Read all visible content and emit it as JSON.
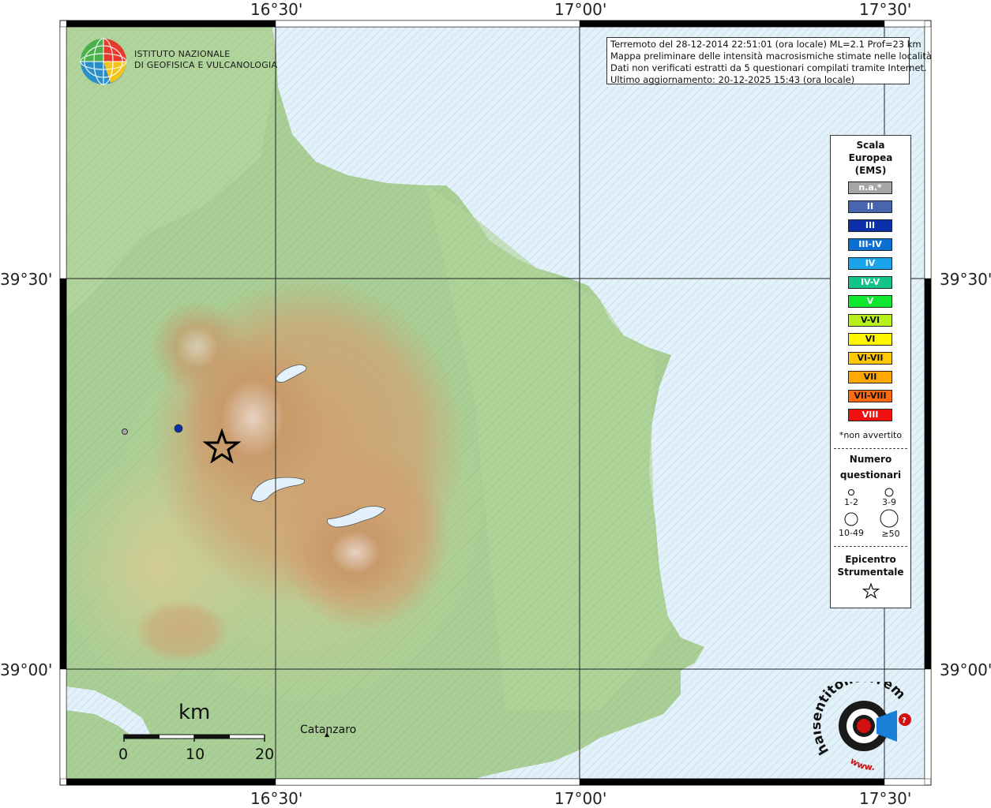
{
  "map": {
    "lon_labels": [
      "16°30'",
      "17°00'",
      "17°30'"
    ],
    "lat_labels": [
      "39°30'",
      "39°00'"
    ],
    "city": "Catanzaro"
  },
  "info": {
    "line1": "Terremoto del 28-12-2014 22:51:01 (ora locale) ML=2.1 Prof=23 km",
    "line2": "Mappa preliminare delle intensità macrosismiche stimate nelle località",
    "line3": "Dati non verificati estratti da 5 questionari compilati tramite Internet.",
    "line4": "Ultimo aggiornamento: 20-12-2025 15:43 (ora locale)"
  },
  "logo": {
    "line1": "ISTITUTO NAZIONALE",
    "line2": "DI GEOFISICA E VULCANOLOGIA"
  },
  "legend": {
    "title1": "Scala",
    "title2": "Europea",
    "title3": "(EMS)",
    "classes": [
      {
        "label": "n.a.*",
        "color": "#a6a6a6"
      },
      {
        "label": "II",
        "color": "#4a65b0"
      },
      {
        "label": "III",
        "color": "#0a2fa8"
      },
      {
        "label": "III-IV",
        "color": "#0b6fd6"
      },
      {
        "label": "IV",
        "color": "#1aa5ea"
      },
      {
        "label": "IV-V",
        "color": "#12c48a"
      },
      {
        "label": "V",
        "color": "#10e830"
      },
      {
        "label": "V-VI",
        "color": "#b8f01a"
      },
      {
        "label": "VI",
        "color": "#fff600"
      },
      {
        "label": "VI-VII",
        "color": "#ffc800"
      },
      {
        "label": "VII",
        "color": "#ffa800"
      },
      {
        "label": "VII-VIII",
        "color": "#ff6a10"
      },
      {
        "label": "VIII",
        "color": "#f01010"
      }
    ],
    "note": "*non avvertito",
    "count_title1": "Numero",
    "count_title2": "questionari",
    "sizes": [
      "1-2",
      "3-9",
      "10-49",
      "≥50"
    ],
    "epi_title1": "Epicentro",
    "epi_title2": "Strumentale"
  },
  "scale_bar": {
    "unit": "km",
    "ticks": [
      "0",
      "10",
      "20"
    ]
  },
  "hsit_logo": {
    "text": "haisentitoilterremoto.it",
    "www": "www."
  },
  "points": [
    {
      "intensity": "n.a.*",
      "questionnaires": "1-2",
      "color": "#a6a6a6"
    },
    {
      "intensity": "III",
      "questionnaires": "1-2",
      "color": "#0a2fa8"
    }
  ]
}
